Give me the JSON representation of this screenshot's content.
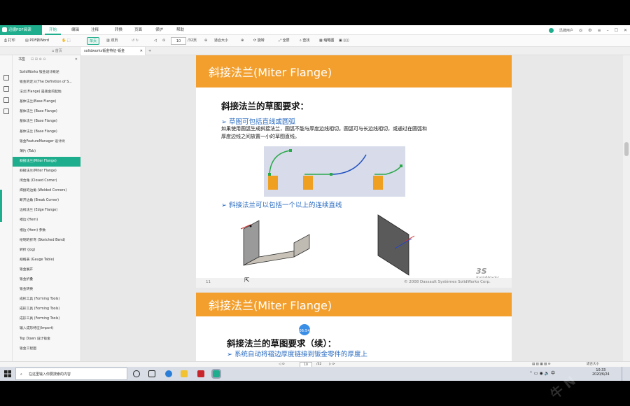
{
  "app": {
    "name": "迅捷PDF阅读",
    "menus": [
      "开始",
      "编辑",
      "注释",
      "转换",
      "页面",
      "保护",
      "帮助"
    ],
    "user": "迅捷用户"
  },
  "toolbar": {
    "print": "打印",
    "pdf_to_word": "PDF转Word",
    "single_page": "单页",
    "double_page": "双页",
    "page_input": "10",
    "page_total": "/32页",
    "fit": "适合大小",
    "rotate": "旋转",
    "full": "全屏",
    "find": "查找",
    "thumbs": "缩略图"
  },
  "tab": {
    "title": "solidworks钣金特征-钣金"
  },
  "outline": {
    "header": "书签",
    "items": [
      "SolidWorks 钣金设计概述",
      "钣金的定义(The Definition of S...",
      "法兰(Flange) 是钣金的起始",
      "基体法兰(Base Flange)",
      "基体法兰 (Base Flange)",
      "基体法兰 (Base Flange)",
      "基体法兰 (Base Flange)",
      "钣金FeatureManager 设计树",
      "薄片 (Tab)",
      "斜接法兰(Miter Flange)",
      "斜接法兰(Miter Flange)",
      "闭合角 (Closed Corner)",
      "焊接的边角 (Welded Corners)",
      "断开边角 (Break Corner)",
      "边线法兰 (Edge Flange)",
      "褶边 (Hem)",
      "褶边 (Hem) 参数",
      "绘制的折弯 (Sketched Bend)",
      "转折 (Jog)",
      "规格表 (Gauge Table)",
      "钣金展开",
      "钣金折叠",
      "钣金转换",
      "成形工具 (Forming Tools)",
      "成形工具 (Forming Tools)",
      "成形工具 (Forming Tools)",
      "输入成形特征(Import)",
      "Top Down 设计钣金",
      "钣金工程图"
    ],
    "active_index": 9
  },
  "slide1": {
    "title": "斜接法兰(Miter Flange)",
    "heading": "斜接法兰的草图要求：",
    "bullet1": "➢ 草图可包括直线或圆弧",
    "text1": "如果使用圆弧生成斜接法兰，圆弧不能与厚度边线相切。圆弧可与长边线相切，或通过在圆弧和",
    "text2": "厚度边线之间放置一小的草图直线。",
    "bullet2": "➢ 斜接法兰可以包括一个以上的连续直线",
    "page_number": "11",
    "brand": "SolidWorks",
    "copyright": "© 2008 Dassault Systèmes SolidWorks Corp."
  },
  "slide2": {
    "title": "斜接法兰(Miter Flange)",
    "heading": "斜接法兰的草图要求（续）：",
    "bullet1": "➢ 系统自动将褶边厚度链接到钣金零件的厚度上"
  },
  "page_badge": "06:54",
  "statusbar": {
    "page": "10",
    "total": "/32",
    "zoom": "适合大小"
  },
  "taskbar": {
    "search_placeholder": "在这里输入你要搜索的内容",
    "time": "10:33",
    "date": "2020/6/24"
  },
  "colors": {
    "accent": "#1fae8d",
    "slide_bar": "#f29f2e",
    "bullet": "#2a6bc0"
  }
}
